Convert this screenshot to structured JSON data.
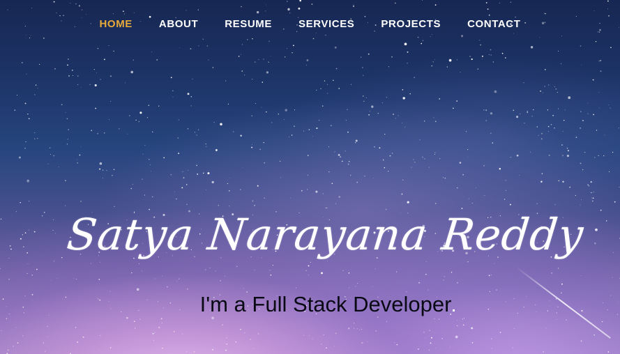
{
  "nav": {
    "items": [
      {
        "label": "HOME",
        "active": true
      },
      {
        "label": "ABOUT",
        "active": false
      },
      {
        "label": "RESUME",
        "active": false
      },
      {
        "label": "SERVICES",
        "active": false
      },
      {
        "label": "PROJECTS",
        "active": false
      },
      {
        "label": "CONTACT",
        "active": false
      }
    ]
  },
  "hero": {
    "name": "Satya Narayana Reddy",
    "tagline": "I'm a Full Stack Developer"
  },
  "colors": {
    "nav_active": "#e7a93a",
    "nav_text": "#ffffff",
    "sky_top": "#172753",
    "sky_bottom": "#a88ac4"
  }
}
